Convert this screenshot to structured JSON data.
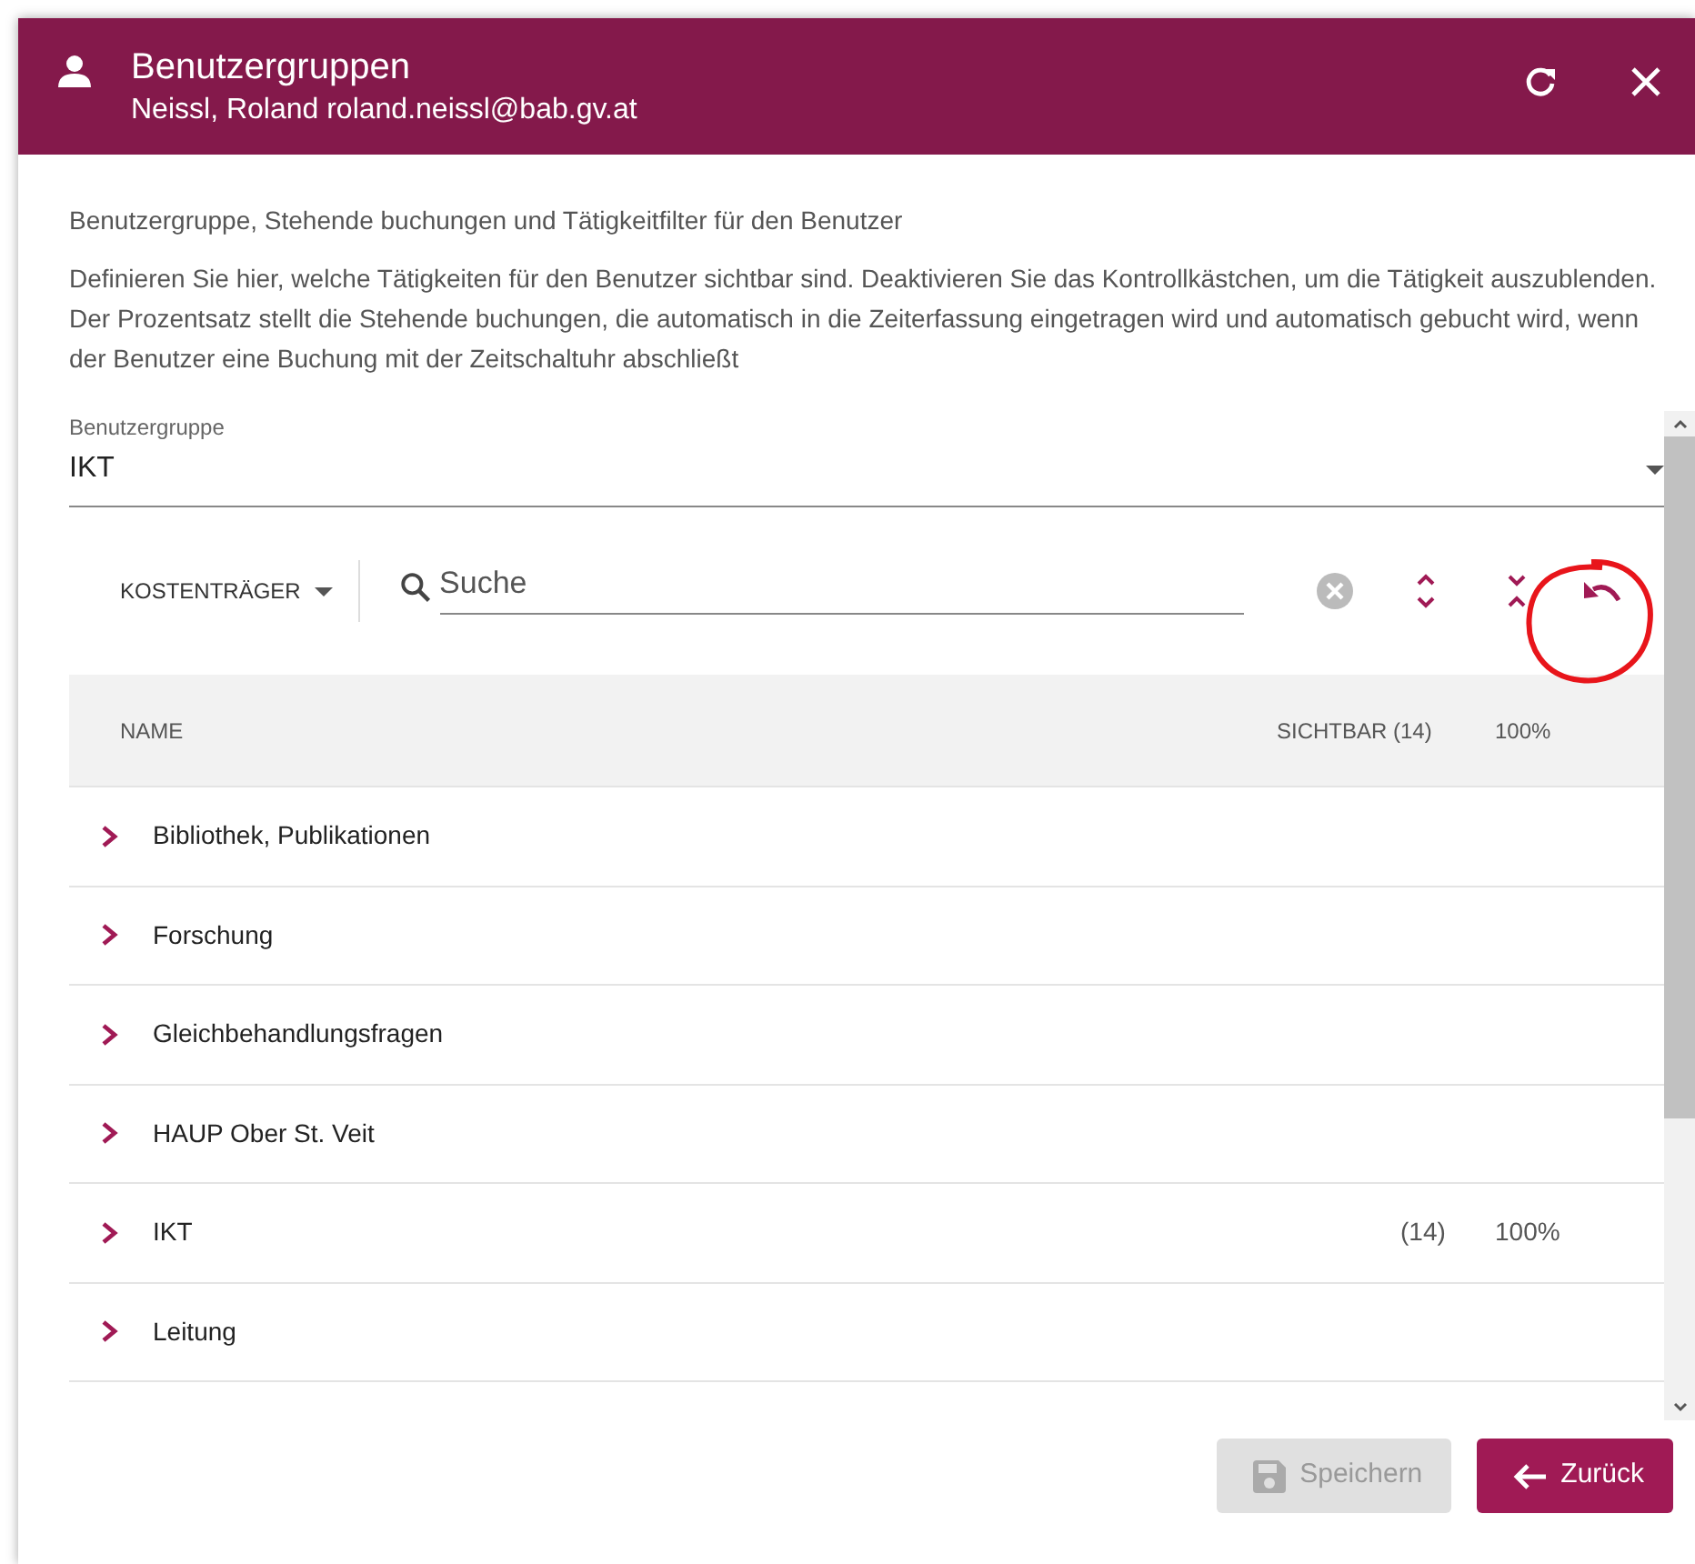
{
  "dialog": {
    "title": "Benutzergruppen",
    "subtitle": "Neissl, Roland roland.neissl@bab.gv.at"
  },
  "intro": "Benutzergruppe, Stehende buchungen und Tätigkeitfilter für den Benutzer",
  "description": "Definieren Sie hier, welche Tätigkeiten für den Benutzer sichtbar sind. Deaktivieren Sie das Kontrollkästchen, um die Tätigkeit auszublenden. Der Prozentsatz stellt die Stehende buchungen, die automatisch in die Zeiterfassung eingetragen wird und automatisch gebucht wird, wenn der Benutzer eine Buchung mit der Zeitschaltuhr abschließt",
  "group_select": {
    "label": "Benutzergruppe",
    "value": "IKT"
  },
  "filter": {
    "type_label": "KOSTENTRÄGER",
    "search_placeholder": "Suche"
  },
  "highlight": {
    "kind": "circle"
  },
  "table": {
    "columns": [
      "NAME",
      "SICHTBAR (14)",
      "100%"
    ],
    "rows": [
      {
        "name": "Bibliothek, Publikationen",
        "expanded": false
      },
      {
        "name": "Forschung",
        "expanded": false
      },
      {
        "name": "Gleichbehandlungsfragen",
        "expanded": false
      },
      {
        "name": "HAUP Ober St. Veit",
        "expanded": false
      },
      {
        "name": "IKT",
        "visible": "(14)",
        "percent": "100%",
        "expanded": false
      },
      {
        "name": "Leitung",
        "expanded": false
      }
    ]
  },
  "buttons": [
    {
      "label": "Speichern",
      "kind": "save",
      "disabled": true
    },
    {
      "label": "Zurück",
      "kind": "back",
      "disabled": false
    }
  ]
}
